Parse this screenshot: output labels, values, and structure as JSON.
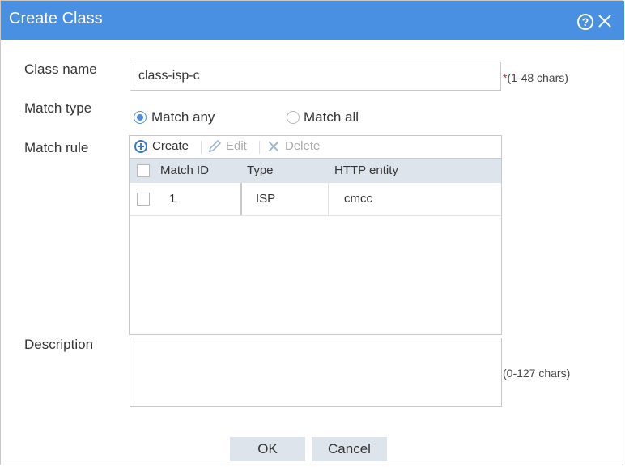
{
  "dialog": {
    "title": "Create Class"
  },
  "form": {
    "class_name": {
      "label": "Class name",
      "value": "class-isp-c",
      "required_mark": "*",
      "hint": "(1-48 chars)"
    },
    "match_type": {
      "label": "Match type",
      "options": [
        {
          "label": "Match any",
          "checked": true
        },
        {
          "label": "Match all",
          "checked": false
        }
      ]
    },
    "match_rule": {
      "label": "Match rule",
      "toolbar": {
        "create": "Create",
        "edit": "Edit",
        "delete": "Delete"
      },
      "columns": [
        "Match ID",
        "Type",
        "HTTP entity"
      ],
      "rows": [
        {
          "id": "1",
          "type": "ISP",
          "entity": "cmcc"
        }
      ]
    },
    "description": {
      "label": "Description",
      "hint": "(0-127 chars)"
    }
  },
  "buttons": {
    "ok": "OK",
    "cancel": "Cancel"
  },
  "colors": {
    "accent": "#4a90e2",
    "header_bg": "#dde4ec",
    "required": "#e02020"
  }
}
